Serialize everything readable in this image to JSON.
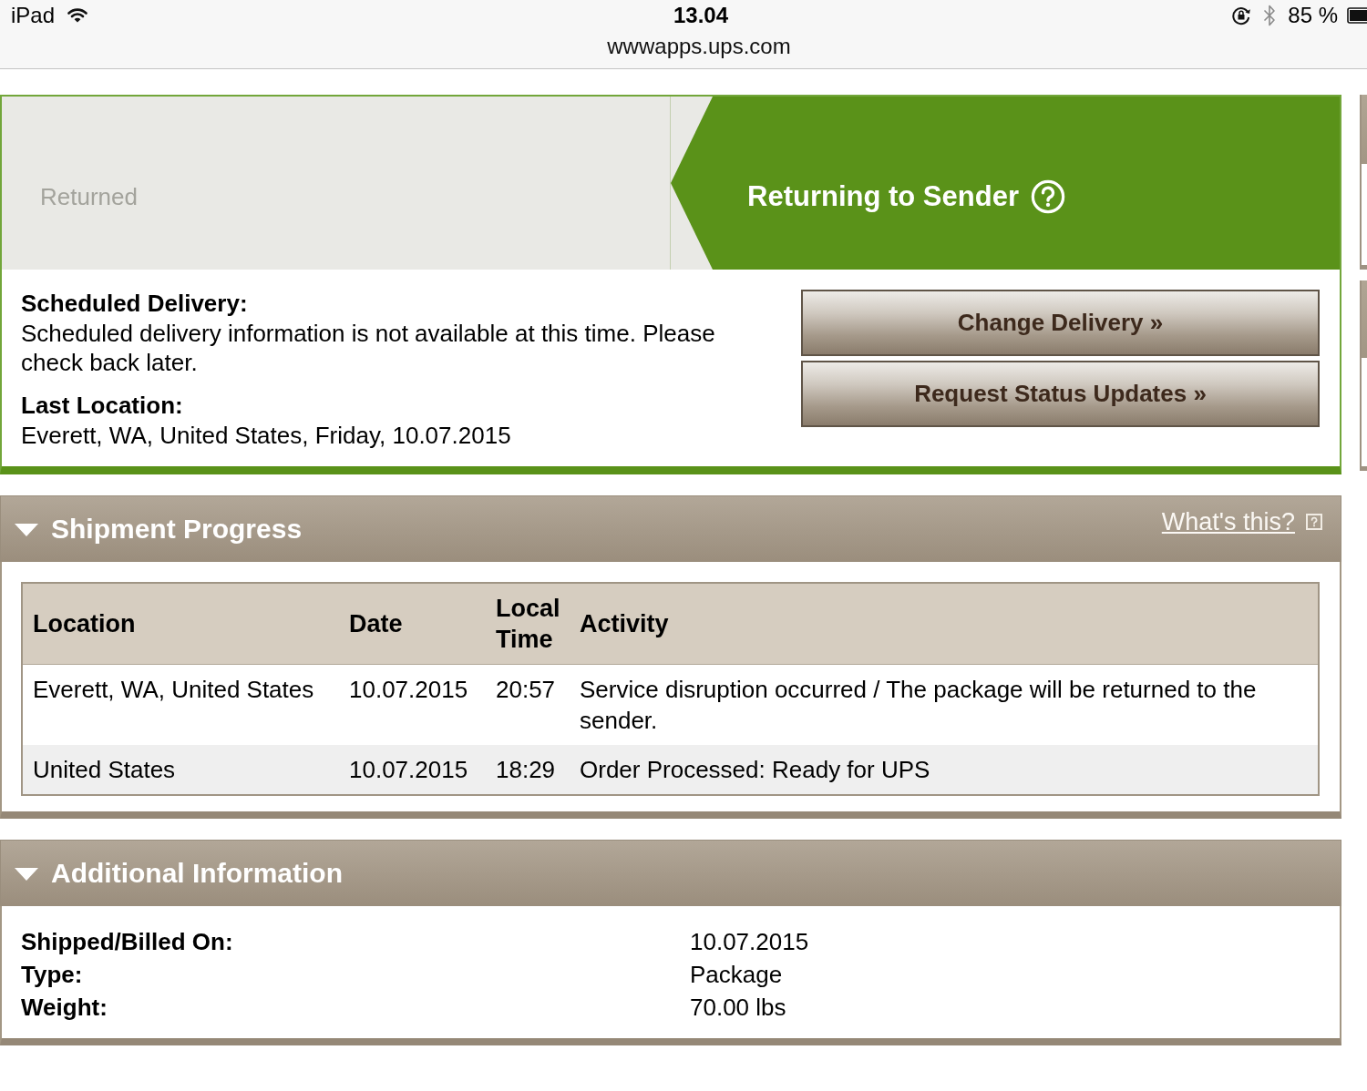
{
  "status_bar": {
    "device": "iPad",
    "time": "13.04",
    "battery": "85 %"
  },
  "address_bar": {
    "url": "wwwapps.ups.com"
  },
  "tracking_card": {
    "progress_steps": [
      {
        "label": "Returned",
        "selected": false
      },
      {
        "label": "Returning to Sender",
        "selected": true
      }
    ],
    "details": [
      {
        "label": "Scheduled Delivery:",
        "text": "Scheduled delivery information is not available at this time. Please check back later."
      },
      {
        "label": "Last Location:",
        "text": "Everett, WA, United States, Friday, 10.07.2015"
      }
    ],
    "buttons": [
      "Change Delivery »",
      "Request Status Updates »"
    ]
  },
  "shipment_progress": {
    "title": "Shipment Progress",
    "expanded": true,
    "help_link": "What's this?",
    "table": {
      "columns": [
        "Location",
        "Date",
        "Local Time",
        "Activity"
      ],
      "rows": [
        {
          "location": "Everett, WA, United States",
          "date": "10.07.2015",
          "local_time": "20:57",
          "activity": "Service disruption occurred / The package will be returned to the sender."
        },
        {
          "location": "United States",
          "date": "10.07.2015",
          "local_time": "18:29",
          "activity": "Order Processed: Ready for UPS"
        }
      ]
    }
  },
  "additional_information": {
    "title": "Additional Information",
    "expanded": true,
    "fields": [
      {
        "label": "Shipped/Billed On:",
        "value": "10.07.2015"
      },
      {
        "label": "Type:",
        "value": "Package"
      },
      {
        "label": "Weight:",
        "value": "70.00 lbs"
      }
    ]
  }
}
